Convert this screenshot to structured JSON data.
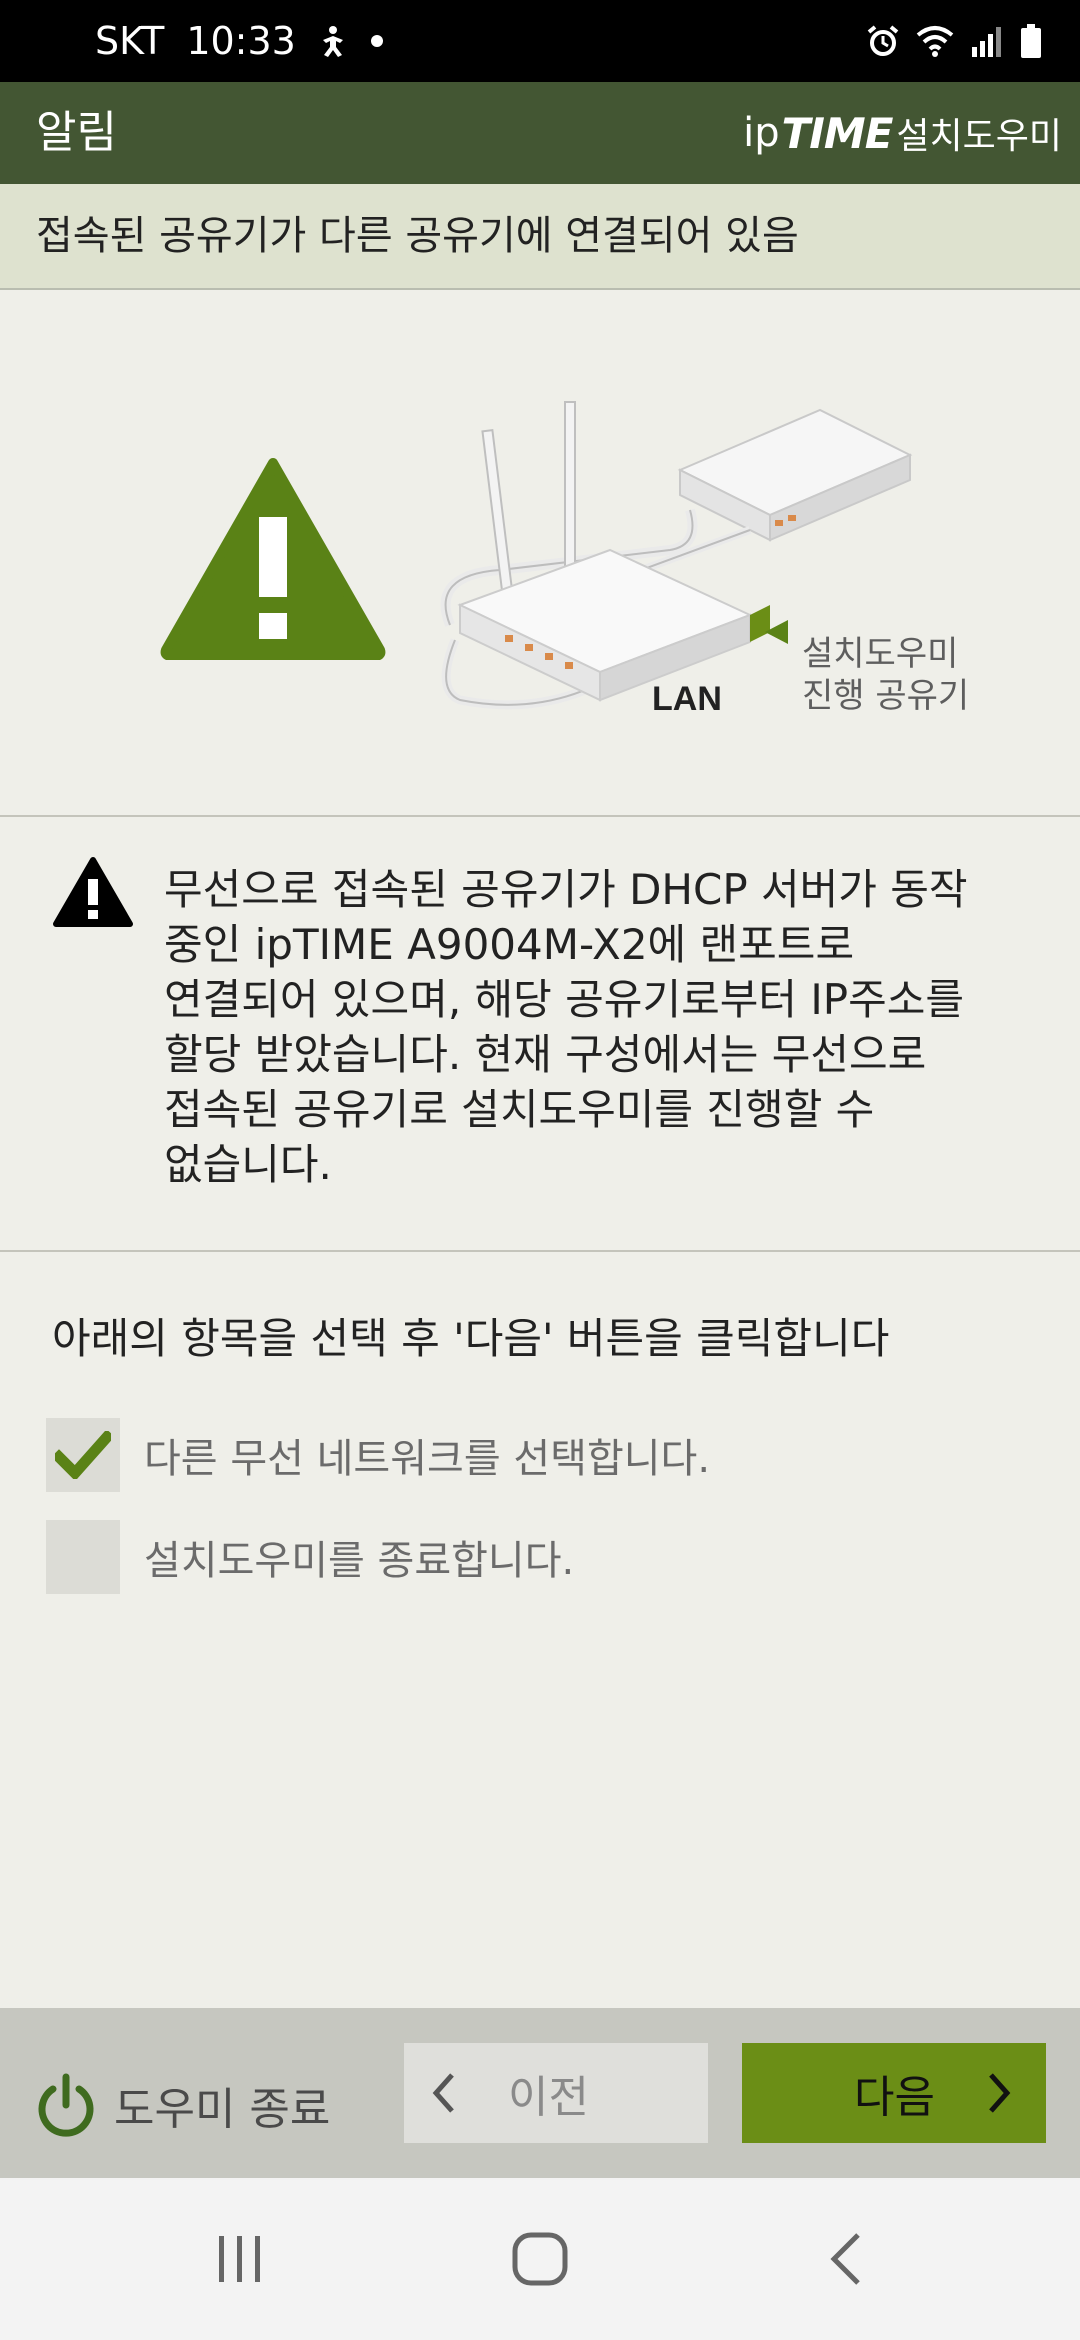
{
  "status_bar": {
    "carrier": "SKT",
    "time": "10:33"
  },
  "header": {
    "title": "알림",
    "brand_ip": "ip",
    "brand_time": "TIME",
    "brand_suffix": "설치도우미"
  },
  "subheader": {
    "text": "접속된 공유기가 다른 공유기에 연결되어 있음"
  },
  "illustration": {
    "lan_label": "LAN",
    "callout_line1": "설치도우미",
    "callout_line2": "진행 공유기"
  },
  "message": {
    "lines": [
      "무선으로 접속된 공유기가 DHCP 서버가 동작",
      "중인 ipTIME A9004M-X2에 랜포트로",
      "연결되어 있으며, 해당 공유기로부터 IP주소를",
      "할당 받았습니다. 현재 구성에서는 무선으로",
      "접속된 공유기로 설치도우미를 진행할 수",
      "없습니다."
    ]
  },
  "instruction": "아래의 항목을 선택 후 '다음' 버튼을 클릭합니다",
  "options": [
    {
      "label": "다른 무선 네트워크를 선택합니다.",
      "checked": true
    },
    {
      "label": "설치도우미를 종료합니다.",
      "checked": false
    }
  ],
  "bottom_bar": {
    "exit_label": "도우미 종료",
    "prev_label": "이전",
    "next_label": "다음"
  },
  "colors": {
    "header_bg": "#435633",
    "subheader_bg": "#dee2cf",
    "accent_green": "#6b8e16",
    "warning_green": "#5a8216",
    "page_bg": "#efefe9"
  }
}
